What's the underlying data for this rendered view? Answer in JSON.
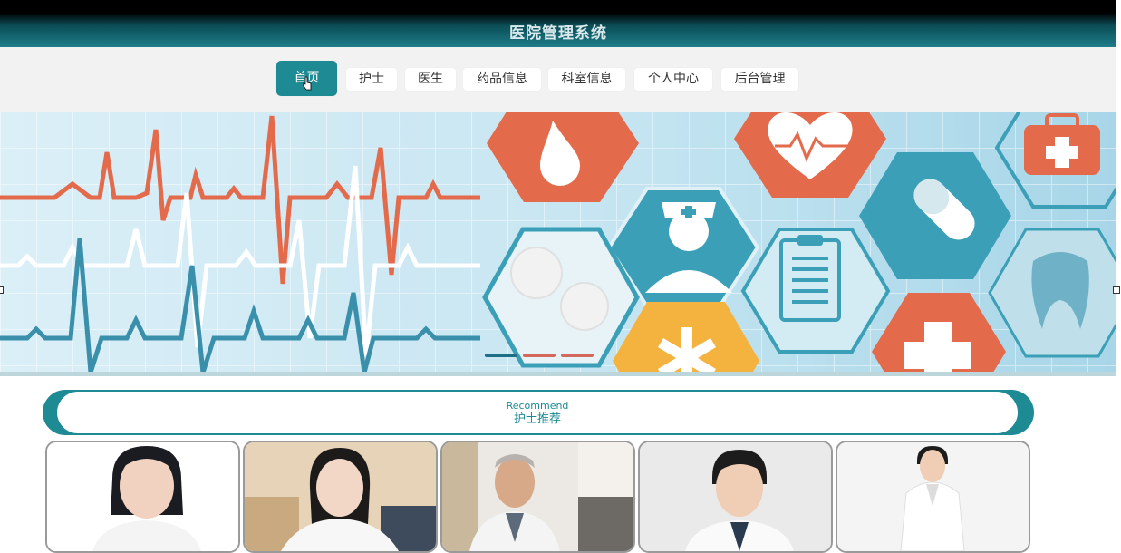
{
  "header": {
    "title": "医院管理系统"
  },
  "nav": {
    "items": [
      {
        "label": "首页",
        "active": true
      },
      {
        "label": "护士",
        "active": false
      },
      {
        "label": "医生",
        "active": false
      },
      {
        "label": "药品信息",
        "active": false
      },
      {
        "label": "科室信息",
        "active": false
      },
      {
        "label": "个人中心",
        "active": false
      },
      {
        "label": "后台管理",
        "active": false
      }
    ]
  },
  "banner": {
    "slides": 3,
    "current_slide": 1
  },
  "recommend": {
    "title_en": "Recommend",
    "title_cn": "护士推荐"
  },
  "colors": {
    "accent": "#1d8a94",
    "header_dark": "#0b4c55",
    "heartbeat_red": "#e36a4a",
    "heartbeat_blue": "#3a8fab",
    "icon_yellow": "#f4b23e"
  },
  "cards": [
    {
      "name": "nurse-card-1"
    },
    {
      "name": "nurse-card-2"
    },
    {
      "name": "nurse-card-3"
    },
    {
      "name": "nurse-card-4"
    },
    {
      "name": "nurse-card-5"
    }
  ]
}
